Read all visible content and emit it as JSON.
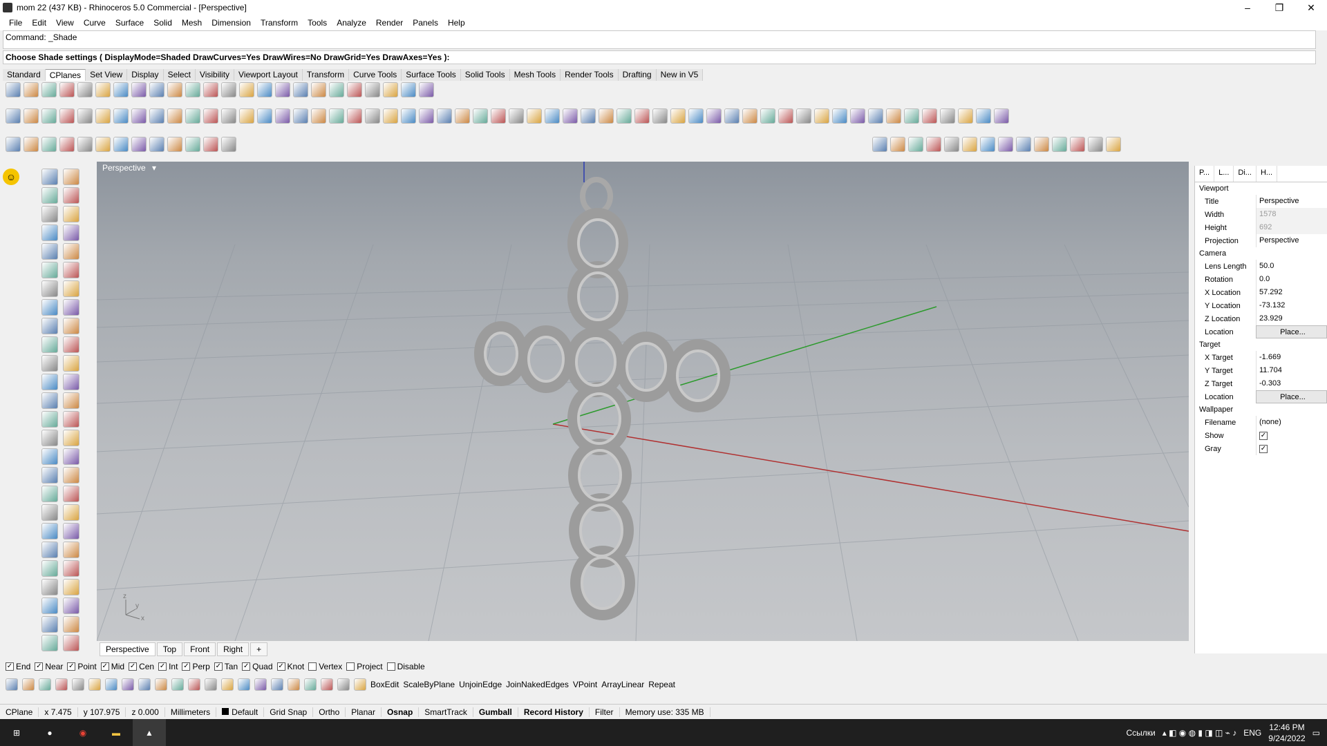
{
  "window": {
    "title": "mom 22 (437 KB) - Rhinoceros 5.0 Commercial - [Perspective]",
    "minimize": "–",
    "maximize": "❐",
    "close": "✕"
  },
  "menu": [
    "File",
    "Edit",
    "View",
    "Curve",
    "Surface",
    "Solid",
    "Mesh",
    "Dimension",
    "Transform",
    "Tools",
    "Analyze",
    "Render",
    "Panels",
    "Help"
  ],
  "command": {
    "history": "Command: _Shade",
    "prompt": "Choose Shade settings ( DisplayMode=Shaded  DrawCurves=Yes  DrawWires=No  DrawGrid=Yes  DrawAxes=Yes ):"
  },
  "toolbar_tabs": [
    "Standard",
    "CPlanes",
    "Set View",
    "Display",
    "Select",
    "Visibility",
    "Viewport Layout",
    "Transform",
    "Curve Tools",
    "Surface Tools",
    "Solid Tools",
    "Mesh Tools",
    "Render Tools",
    "Drafting",
    "New in V5"
  ],
  "active_toolbar_tab": "CPlanes",
  "viewport": {
    "label": "Perspective",
    "tabs": [
      "Perspective",
      "Top",
      "Front",
      "Right"
    ],
    "active_tab": "Perspective",
    "add_tab": "+"
  },
  "panel": {
    "tabs": [
      "P...",
      "L...",
      "Di...",
      "H..."
    ],
    "sections": [
      {
        "title": "Viewport",
        "rows": [
          {
            "key": "Title",
            "value": "Perspective",
            "style": ""
          },
          {
            "key": "Width",
            "value": "1578",
            "style": "dim"
          },
          {
            "key": "Height",
            "value": "692",
            "style": "dim"
          },
          {
            "key": "Projection",
            "value": "Perspective",
            "style": ""
          }
        ]
      },
      {
        "title": "Camera",
        "rows": [
          {
            "key": "Lens Length",
            "value": "50.0",
            "style": ""
          },
          {
            "key": "Rotation",
            "value": "0.0",
            "style": ""
          },
          {
            "key": "X Location",
            "value": "57.292",
            "style": ""
          },
          {
            "key": "Y Location",
            "value": "-73.132",
            "style": ""
          },
          {
            "key": "Z Location",
            "value": "23.929",
            "style": ""
          },
          {
            "key": "Location",
            "value": "Place...",
            "style": "btn"
          }
        ]
      },
      {
        "title": "Target",
        "rows": [
          {
            "key": "X Target",
            "value": "-1.669",
            "style": ""
          },
          {
            "key": "Y Target",
            "value": "11.704",
            "style": ""
          },
          {
            "key": "Z Target",
            "value": "-0.303",
            "style": ""
          },
          {
            "key": "Location",
            "value": "Place...",
            "style": "btn"
          }
        ]
      },
      {
        "title": "Wallpaper",
        "rows": [
          {
            "key": "Filename",
            "value": "(none)",
            "style": ""
          },
          {
            "key": "Show",
            "value": "✓",
            "style": "check"
          },
          {
            "key": "Gray",
            "value": "✓",
            "style": "check"
          }
        ]
      }
    ]
  },
  "osnap": [
    {
      "label": "End",
      "checked": true
    },
    {
      "label": "Near",
      "checked": true
    },
    {
      "label": "Point",
      "checked": true
    },
    {
      "label": "Mid",
      "checked": true
    },
    {
      "label": "Cen",
      "checked": true
    },
    {
      "label": "Int",
      "checked": true
    },
    {
      "label": "Perp",
      "checked": true
    },
    {
      "label": "Tan",
      "checked": true
    },
    {
      "label": "Quad",
      "checked": true
    },
    {
      "label": "Knot",
      "checked": true
    },
    {
      "label": "Vertex",
      "checked": false
    },
    {
      "label": "Project",
      "checked": false
    },
    {
      "label": "Disable",
      "checked": false
    }
  ],
  "bottom_commands": [
    "BoxEdit",
    "ScaleByPlane",
    "UnjoinEdge",
    "JoinNakedEdges",
    "VPoint",
    "ArrayLinear",
    "Repeat"
  ],
  "status": {
    "cplane": "CPlane",
    "x": "x 7.475",
    "y": "y 107.975",
    "z": "z 0.000",
    "units": "Millimeters",
    "layer": "Default",
    "toggles": [
      {
        "label": "Grid Snap",
        "bold": false
      },
      {
        "label": "Ortho",
        "bold": false
      },
      {
        "label": "Planar",
        "bold": false
      },
      {
        "label": "Osnap",
        "bold": true
      },
      {
        "label": "SmartTrack",
        "bold": false
      },
      {
        "label": "Gumball",
        "bold": true
      },
      {
        "label": "Record History",
        "bold": true
      },
      {
        "label": "Filter",
        "bold": false
      }
    ],
    "memory": "Memory use: 335 MB"
  },
  "taskbar": {
    "links": "Ссылки",
    "lang": "ENG",
    "time": "12:46 PM",
    "date": "9/24/2022"
  },
  "axis_colors": {
    "x": "#b03030",
    "y": "#2c9a2c",
    "z": "#2a3bb0"
  }
}
